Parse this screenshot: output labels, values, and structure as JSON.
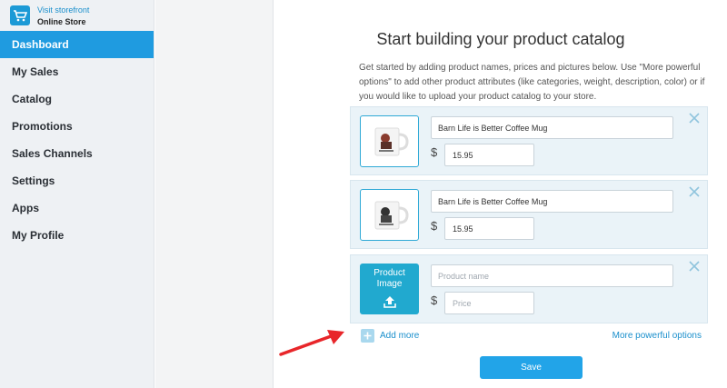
{
  "sidebar": {
    "visit_storefront": "Visit storefront",
    "store_name": "Online Store",
    "logo_icon": "shopping-cart-icon",
    "items": [
      {
        "label": "Dashboard",
        "active": true
      },
      {
        "label": "My Sales"
      },
      {
        "label": "Catalog"
      },
      {
        "label": "Promotions"
      },
      {
        "label": "Sales Channels"
      },
      {
        "label": "Settings"
      },
      {
        "label": "Apps"
      },
      {
        "label": "My Profile"
      }
    ]
  },
  "main": {
    "title": "Start building your product catalog",
    "intro": "Get started by adding product names, prices and pictures below. Use \"More powerful options\" to add other product attributes (like categories, weight, description, color) or if you would like to upload your product catalog to your store.",
    "products": [
      {
        "name": "Barn Life is Better Coffee Mug",
        "currency": "$",
        "price": "15.95"
      },
      {
        "name": "Barn Life is Better Coffee Mug",
        "currency": "$",
        "price": "15.95"
      }
    ],
    "new_product": {
      "image_label_line1": "Product",
      "image_label_line2": "Image",
      "name_placeholder": "Product name",
      "currency": "$",
      "price_placeholder": "Price"
    },
    "add_more": "Add more",
    "more_options": "More powerful options",
    "save": "Save"
  },
  "colors": {
    "accent": "#1f9be0",
    "card_bg": "#eaf3f8",
    "link": "#1a8fcc",
    "arrow": "#e8262a"
  }
}
